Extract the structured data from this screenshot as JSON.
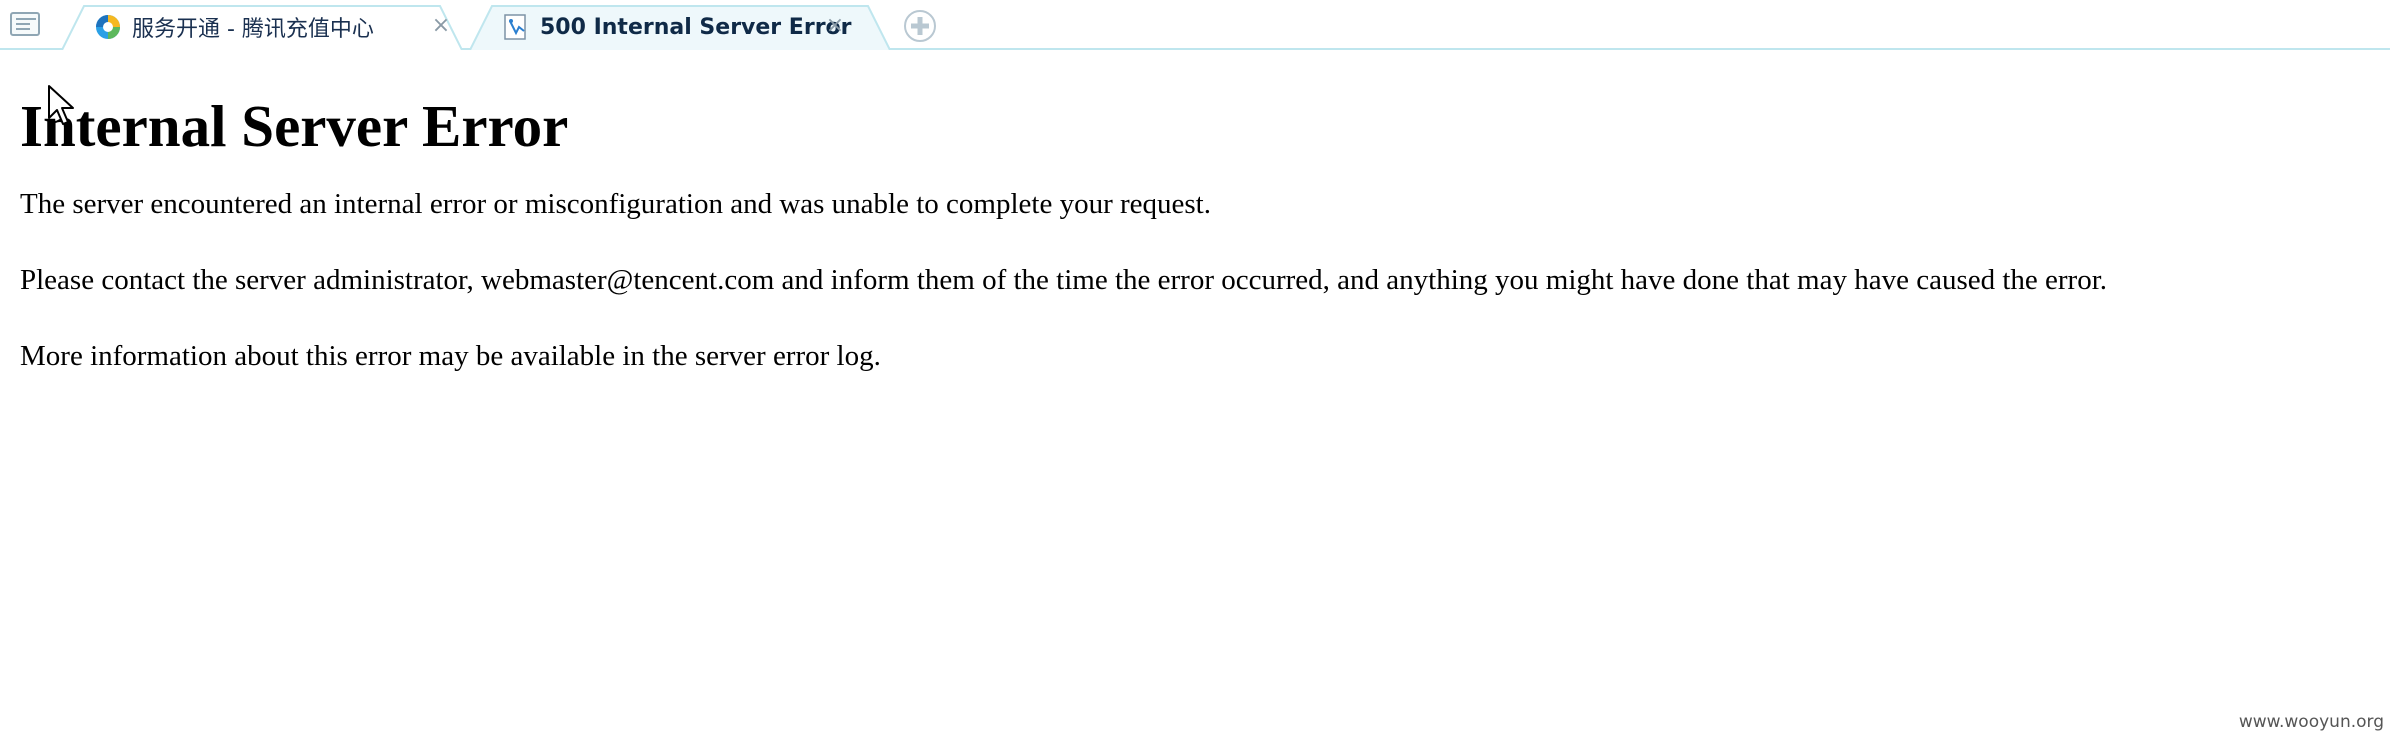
{
  "browser": {
    "tabs": [
      {
        "title": "服务开通 - 腾讯充值中心",
        "favicon": "tencent-logo-icon",
        "active": false
      },
      {
        "title": "500 Internal Server Error",
        "favicon": "page-icon",
        "active": true
      }
    ],
    "close_glyph": "×",
    "new_tab_icon": "plus-circle-icon",
    "sidebar_icon": "sidebar-toggle-icon"
  },
  "page": {
    "heading": "Internal Server Error",
    "paragraphs": [
      "The server encountered an internal error or misconfiguration and was unable to complete your request.",
      "Please contact the server administrator, webmaster@tencent.com and inform them of the time the error occurred, and anything you might have done that may have caused the error.",
      "More information about this error may be available in the server error log."
    ]
  },
  "watermark": "www.wooyun.org",
  "colors": {
    "tab_border": "#bfe6ee",
    "tab_active_fill": "#eef8fb",
    "tab_title": "#1a3050"
  }
}
